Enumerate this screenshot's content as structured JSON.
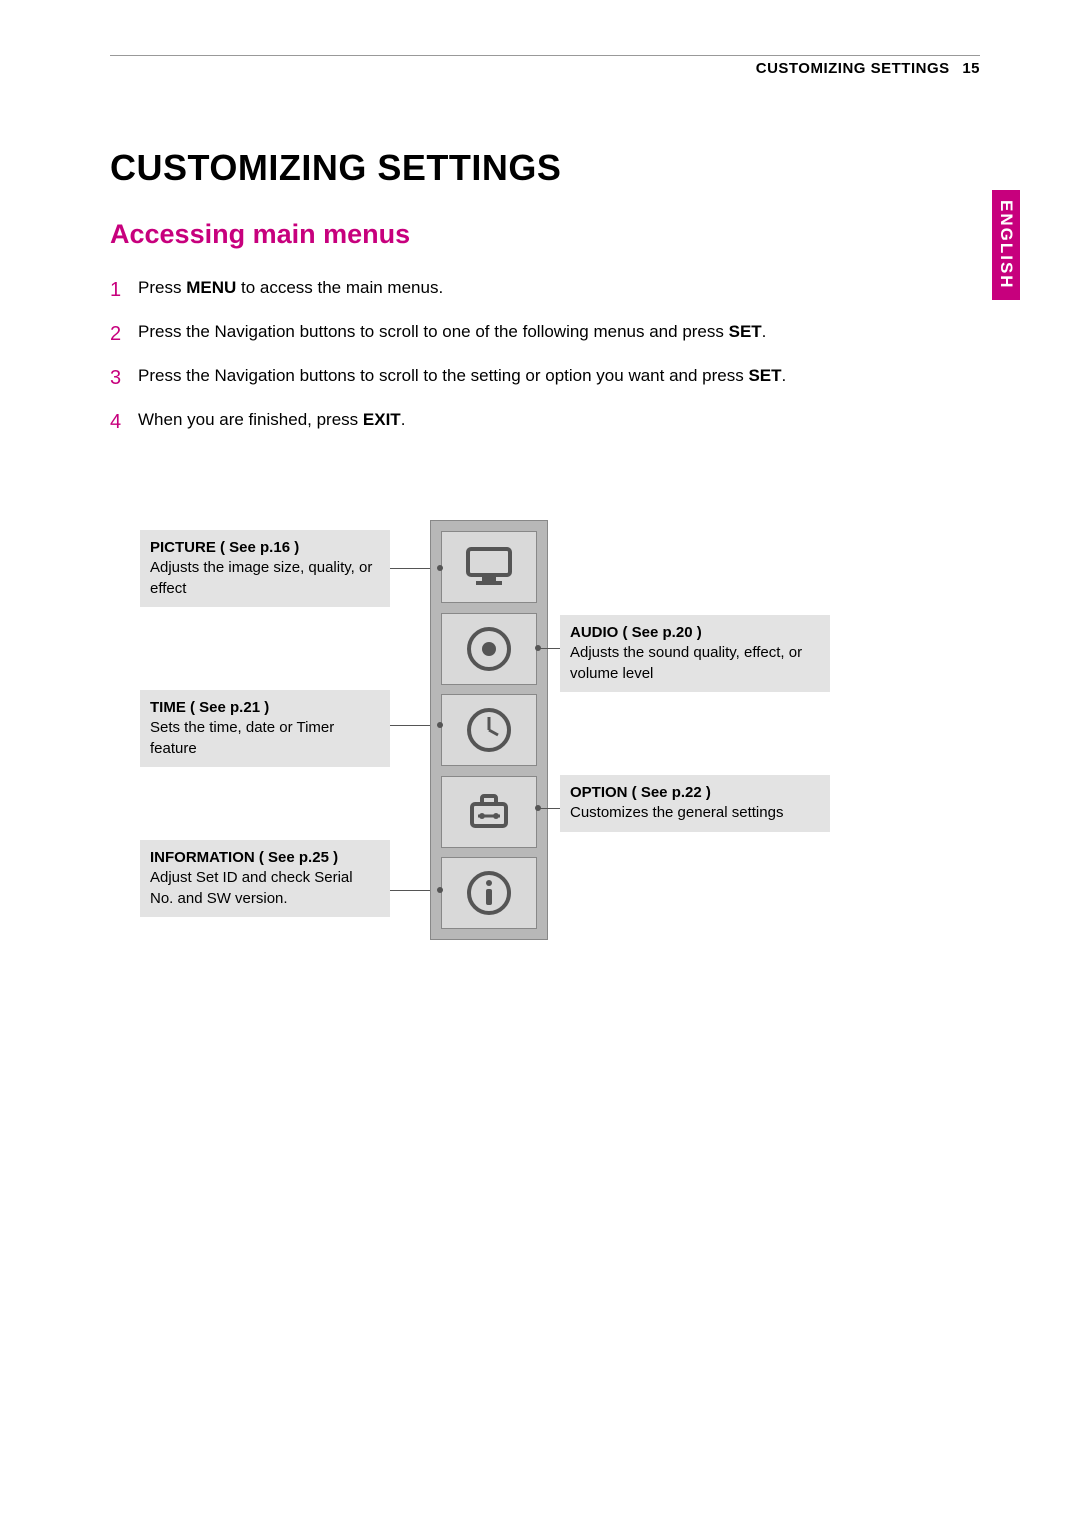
{
  "header": {
    "section": "CUSTOMIZING SETTINGS",
    "page": "15"
  },
  "language_tab": "ENGLISH",
  "title": "CUSTOMIZING SETTINGS",
  "subtitle": "Accessing main menus",
  "steps": [
    {
      "n": "1",
      "pre": "Press ",
      "b": "MENU",
      "post": " to access the main menus."
    },
    {
      "n": "2",
      "pre": "Press the Navigation buttons to scroll to one of the following menus and press ",
      "b": "SET",
      "post": "."
    },
    {
      "n": "3",
      "pre": "Press the Navigation buttons to scroll to the setting or option you want and press ",
      "b": "SET",
      "post": "."
    },
    {
      "n": "4",
      "pre": "When you are finished, press ",
      "b": "EXIT",
      "post": "."
    }
  ],
  "callouts": {
    "picture": {
      "title": "PICTURE ( See p.16 )",
      "desc": "Adjusts the image size, quality, or effect"
    },
    "audio": {
      "title": "AUDIO ( See p.20 )",
      "desc": "Adjusts the sound quality, effect, or volume level"
    },
    "time": {
      "title": "TIME ( See p.21 )",
      "desc": "Sets the time, date or Timer feature"
    },
    "option": {
      "title": "OPTION ( See p.22 )",
      "desc": "Customizes the general settings"
    },
    "information": {
      "title": "INFORMATION ( See p.25 )",
      "desc": "Adjust Set ID and check Serial No. and SW version."
    }
  }
}
